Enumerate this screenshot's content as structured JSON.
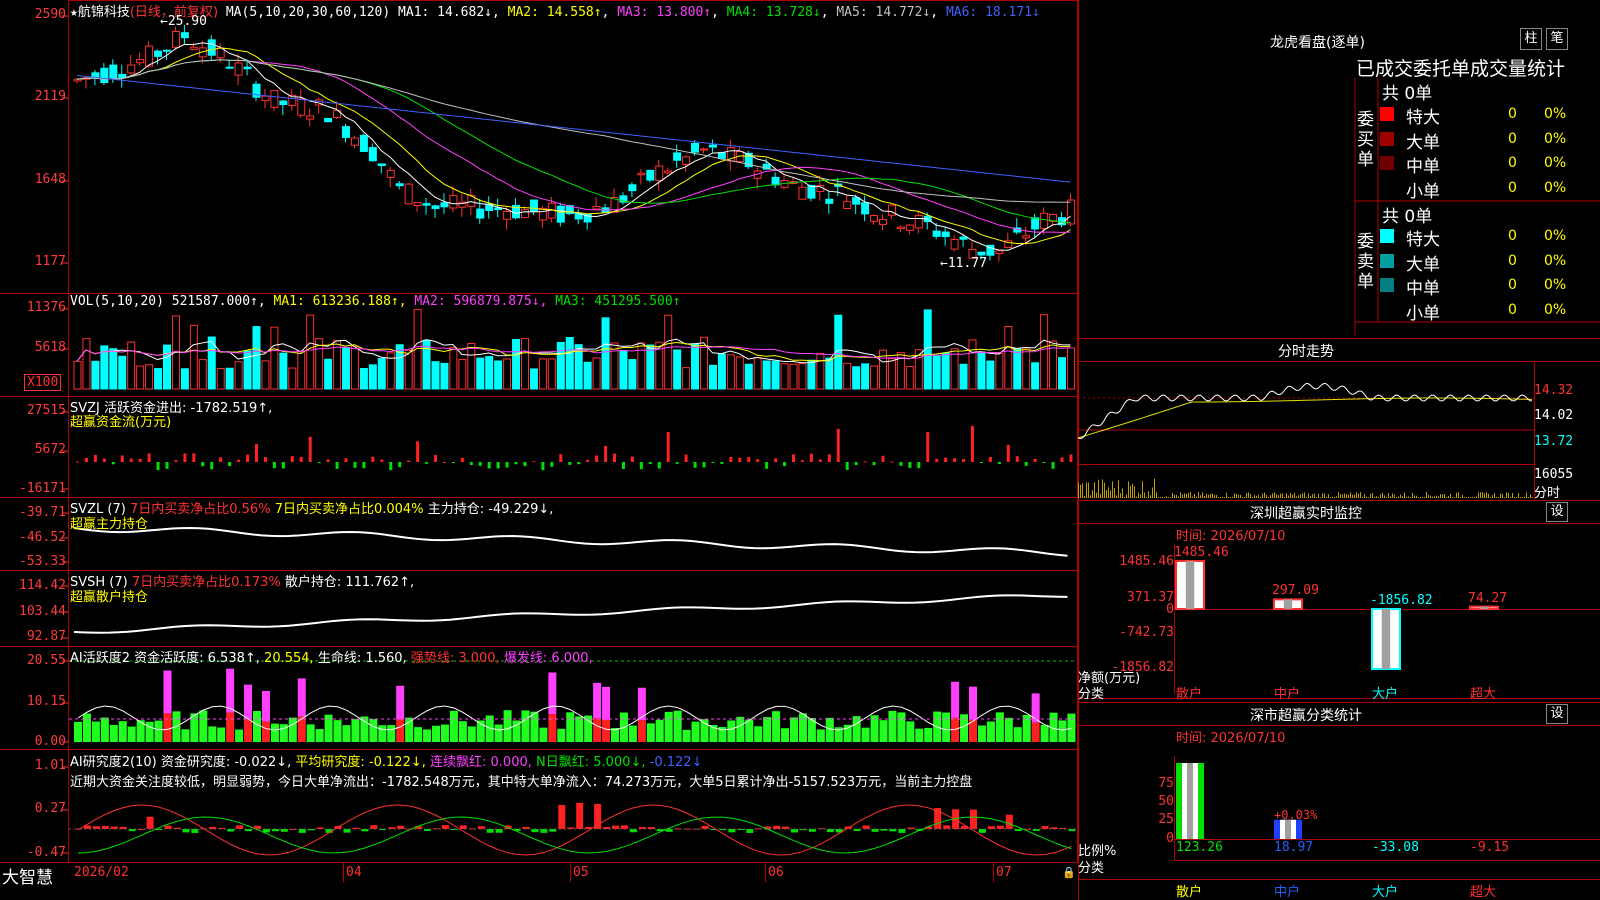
{
  "stock": {
    "name": "航锦科技",
    "mode": "日线，前复权"
  },
  "main_ma": {
    "label": "MA(5,10,20,30,60,120)",
    "ma1": "MA1: 14.682↓",
    "ma2": "MA2: 14.558↑",
    "ma3": "MA3: 13.800↑",
    "ma4": "MA4: 13.728↓",
    "ma5": "MA5: 14.772↓",
    "ma6": "MA6: 18.171↓"
  },
  "price_axis": [
    "2590",
    "2119",
    "1648",
    "1177"
  ],
  "price_marks": {
    "high": "25.90",
    "low": "←11.77"
  },
  "vol": {
    "label": "VOL(5,10,20)",
    "value": "521587.000↑,",
    "ma1": "MA1: 613236.188↑,",
    "ma2": "MA2: 596879.875↓,",
    "ma3": "MA3: 451295.500↑",
    "axis": [
      "11376",
      "5618"
    ],
    "unit": "X100"
  },
  "svzj": {
    "label": "SVZJ  活跃资金进出: -1782.519↑,",
    "sub": "超赢资金流(万元)",
    "axis": [
      "27515",
      "5672",
      "-16171"
    ]
  },
  "svzl": {
    "label": "SVZL (7)",
    "a": "7日内买卖净占比0.56%",
    "b": "7日内买卖净占比0.004%",
    "c": "主力持仓: -49.229↓,",
    "sub": "超赢主力持仓",
    "axis": [
      "-39.71",
      "-46.52",
      "-53.33"
    ]
  },
  "svsh": {
    "label": "SVSH (7)",
    "a": "7日内买卖净占比0.173%",
    "c": "散户持仓: 111.762↑,",
    "sub": "超赢散户持仓",
    "axis": [
      "114.42",
      "103.44",
      "92.87"
    ]
  },
  "ai1": {
    "label": "AI活跃度2",
    "a": "资金活跃度: 6.538↑,",
    "b": "20.554,",
    "c": "生命线: 1.560,",
    "d": "强势线: 3.000,",
    "e": "爆发线: 6.000,",
    "axis": [
      "20.55",
      "10.15",
      "0.00"
    ]
  },
  "ai2": {
    "label": "AI研究度2(10)",
    "a": "资金研究度: -0.022↓,",
    "b": "平均研究度: -0.122↓,",
    "c": "连续飘红: 0.000,",
    "d": "N日飘红: 5.000↓,",
    "e": "-0.122↓",
    "axis": [
      "1.01",
      "0.27",
      "-0.47"
    ],
    "note": "近期大资金关注度较低，明显弱势，今日大单净流出：-1782.548万元，其中特大单净流入：74.273万元，大单5日累计净出-5157.523万元，当前主力控盘"
  },
  "dates": [
    "2026/02",
    "04",
    "05",
    "06",
    "07"
  ],
  "brand": "大智慧",
  "lhb": {
    "title": "龙虎看盘(逐单)",
    "btn_zhu": "柱",
    "btn_bi": "笔",
    "subtitle": "已成交委托单成交量统计",
    "buy_label": "委买单",
    "sell_label": "委卖单",
    "buy_total": "共 0单",
    "sell_total": "共 0单",
    "buy_rows": [
      {
        "name": "特大",
        "n": "0",
        "p": "0%",
        "color": "#ff0000"
      },
      {
        "name": "大单",
        "n": "0",
        "p": "0%",
        "color": "#a00000"
      },
      {
        "name": "中单",
        "n": "0",
        "p": "0%",
        "color": "#700000"
      },
      {
        "name": "小单",
        "n": "0",
        "p": "0%",
        "color": "#000000"
      }
    ],
    "sell_rows": [
      {
        "name": "特大",
        "n": "0",
        "p": "0%",
        "color": "#00ffff"
      },
      {
        "name": "大单",
        "n": "0",
        "p": "0%",
        "color": "#00a0a0"
      },
      {
        "name": "中单",
        "n": "0",
        "p": "0%",
        "color": "#008080"
      },
      {
        "name": "小单",
        "n": "0",
        "p": "0%",
        "color": "#000000"
      }
    ]
  },
  "fs": {
    "title": "分时走势",
    "axis": [
      "14.32",
      "14.02",
      "13.72"
    ],
    "vol_axis": "16055",
    "vol_label": "分时"
  },
  "sz_monitor": {
    "title": "深圳超赢实时监控",
    "btn": "设",
    "time": "时间: 2026/07/10",
    "axis": [
      "1485.46",
      "371.37",
      "0",
      "-742.73",
      "-1856.82"
    ],
    "unit": "净额(万元)",
    "cat_label": "分类",
    "bars": [
      {
        "cat": "散户",
        "label": "1485.46",
        "value": 1485.46
      },
      {
        "cat": "中户",
        "label": "297.09",
        "value": 297.09
      },
      {
        "cat": "大户",
        "label": "-1856.82",
        "value": -1856.82
      },
      {
        "cat": "超大",
        "label": "74.27",
        "value": 74.27
      }
    ]
  },
  "sz_class": {
    "title": "深市超赢分类统计",
    "btn": "设",
    "time": "时间: 2026/07/10",
    "axis": [
      "75",
      "50",
      "25",
      "0"
    ],
    "ratio_label": "比例%",
    "cat_label": "分类",
    "bars": [
      {
        "cat": "散户",
        "label": "123.26",
        "value": 123.26
      },
      {
        "cat": "中户",
        "label": "18.97",
        "value": 18.97,
        "top": "+0.03%"
      },
      {
        "cat": "大户",
        "label": "-33.08",
        "value": -33.08
      },
      {
        "cat": "超大",
        "label": "-9.15",
        "value": -9.15
      }
    ]
  },
  "chart_data": {
    "type": "candlestick",
    "title": "航锦科技 日线 前复权",
    "price_range": [
      11.77,
      25.9
    ],
    "x_labels": [
      "2026/02",
      "04",
      "05",
      "06",
      "07"
    ],
    "ma": {
      "MA1": 14.682,
      "MA2": 14.558,
      "MA3": 13.8,
      "MA4": 13.728,
      "MA5": 14.772,
      "MA6": 18.171
    }
  }
}
